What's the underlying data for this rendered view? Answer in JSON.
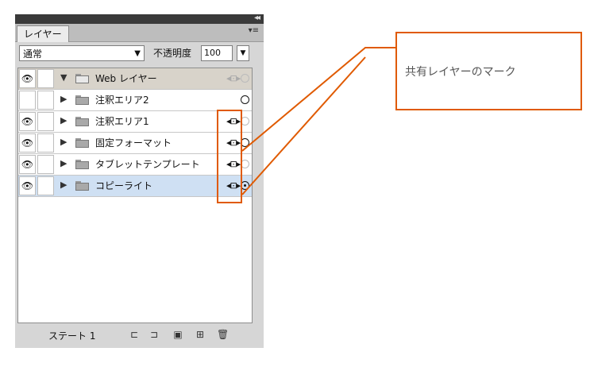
{
  "panel": {
    "tab_label": "レイヤー",
    "collapse_glyph": "◂◂",
    "menu_glyph": "▾≡"
  },
  "controls": {
    "blend_mode": "通常",
    "opacity_label": "不透明度",
    "opacity_value": "100"
  },
  "layers": [
    {
      "name": "Web レイヤー",
      "visible": true,
      "expanded": true
    },
    {
      "name": "注釈エリア2",
      "visible": false,
      "expanded": false
    },
    {
      "name": "注釈エリア1",
      "visible": true,
      "expanded": false
    },
    {
      "name": "固定フォーマット",
      "visible": true,
      "expanded": false
    },
    {
      "name": "タブレットテンプレート",
      "visible": true,
      "expanded": false
    },
    {
      "name": "コピーライト",
      "visible": true,
      "expanded": false,
      "selected": true
    }
  ],
  "footer": {
    "state_label": "ステート 1"
  },
  "callout": {
    "text": "共有レイヤーのマーク"
  },
  "colors": {
    "accent": "#e05a00",
    "selected_row": "#cfe0f3"
  }
}
